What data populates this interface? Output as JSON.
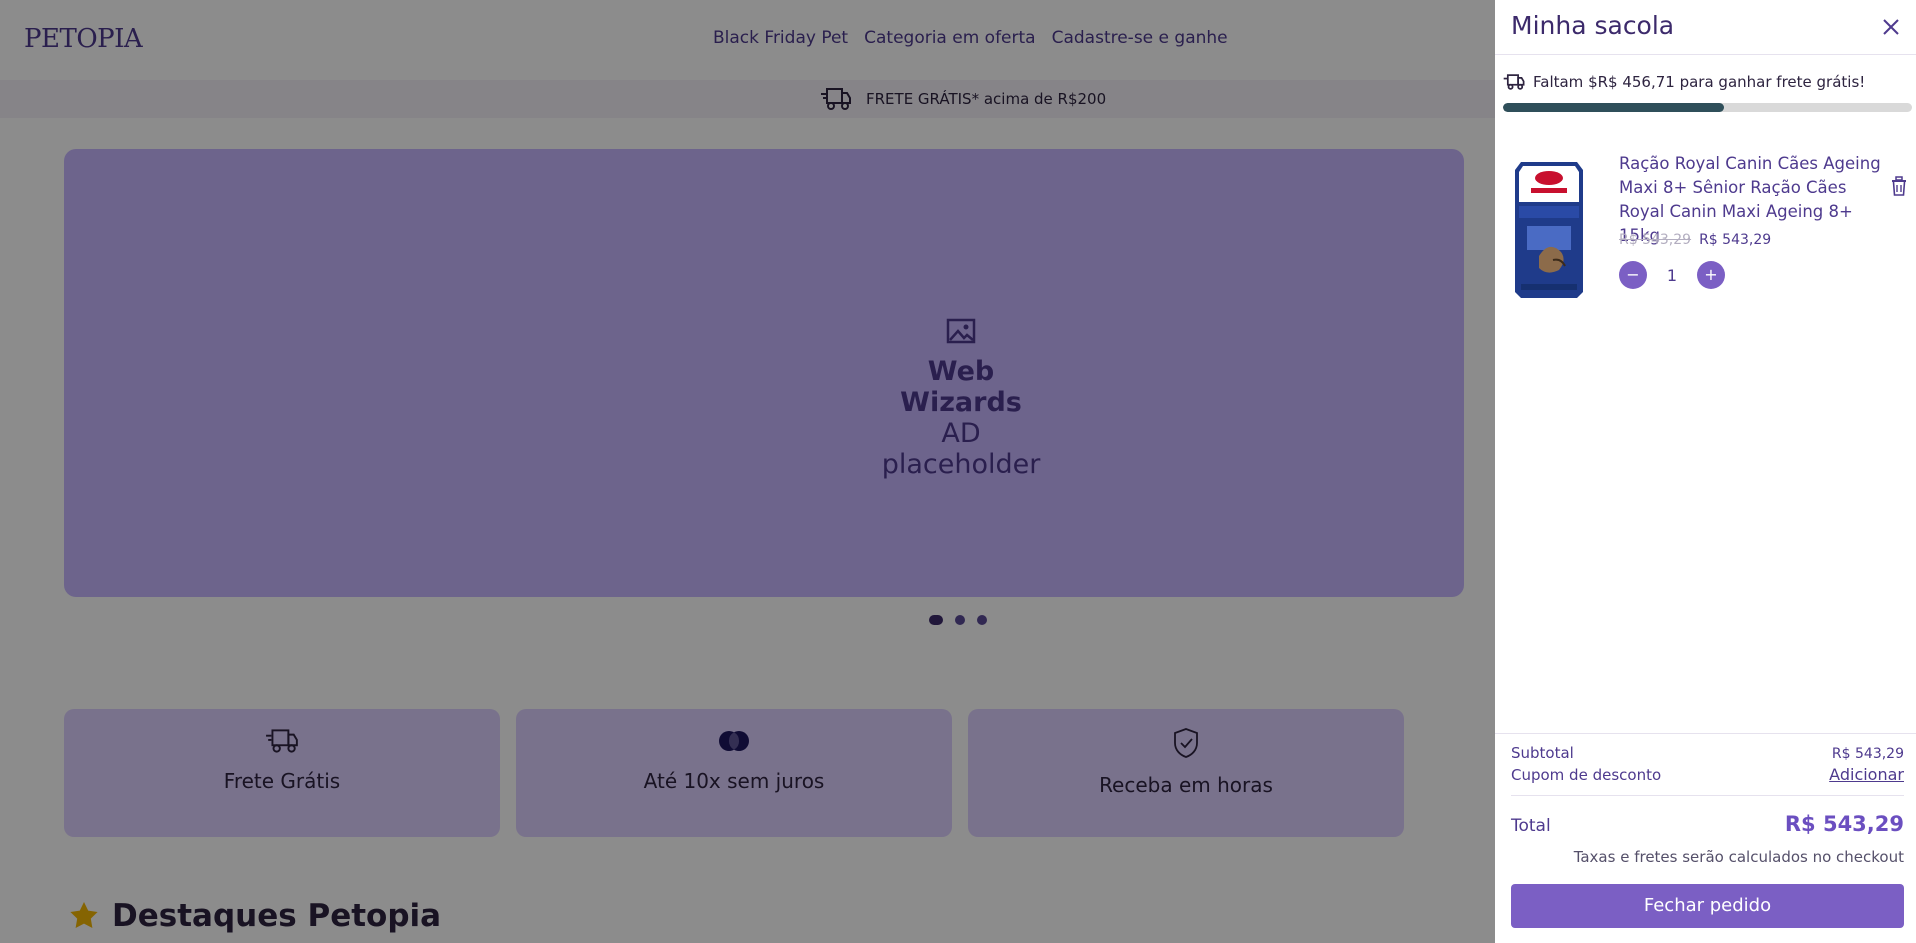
{
  "header": {
    "logo": "PETOPIA",
    "nav": [
      {
        "label": "Black Friday Pet"
      },
      {
        "label": "Categoria em oferta"
      },
      {
        "label": "Cadastre-se e ganhe"
      }
    ]
  },
  "promo": {
    "text": "FRETE GRÁTIS* acima de R$200",
    "icon": "truck-icon"
  },
  "banner": {
    "icon": "image-icon",
    "title": "Web Wizards",
    "subtitle": "AD placeholder",
    "slides": 3,
    "active_slide": 1
  },
  "features": [
    {
      "label": "Frete Grátis",
      "icon": "truck-icon"
    },
    {
      "label": "Até 10x sem juros",
      "icon": "credit-card-icon"
    },
    {
      "label": "Receba em horas",
      "icon": "shield-check-icon"
    }
  ],
  "section": {
    "title": "Destaques Petopia",
    "icon": "star-icon"
  },
  "cart": {
    "title": "Minha sacola",
    "shipping_message": "Faltam $R$ 456,71 para ganhar frete grátis!",
    "shipping_progress": 0.54,
    "items": [
      {
        "name": "Ração Royal Canin Cães Ageing Maxi 8+ Sênior Ração Cães Royal Canin Maxi Ageing 8+ 15kg",
        "old_price": "R$ 543,29",
        "price": "R$ 543,29",
        "quantity": "1",
        "minus": "−",
        "plus": "+"
      }
    ],
    "subtotal_label": "Subtotal",
    "subtotal_value": "R$ 543,29",
    "coupon_label": "Cupom de desconto",
    "coupon_action": "Adicionar",
    "total_label": "Total",
    "total_value": "R$ 543,29",
    "note": "Taxas e fretes serão calculados no checkout",
    "checkout_label": "Fechar pedido"
  },
  "colors": {
    "brand": "#4e3a8e",
    "accent": "#7b5fc4",
    "banner": "#c7b7ff",
    "progress": "#2f4f5a"
  }
}
